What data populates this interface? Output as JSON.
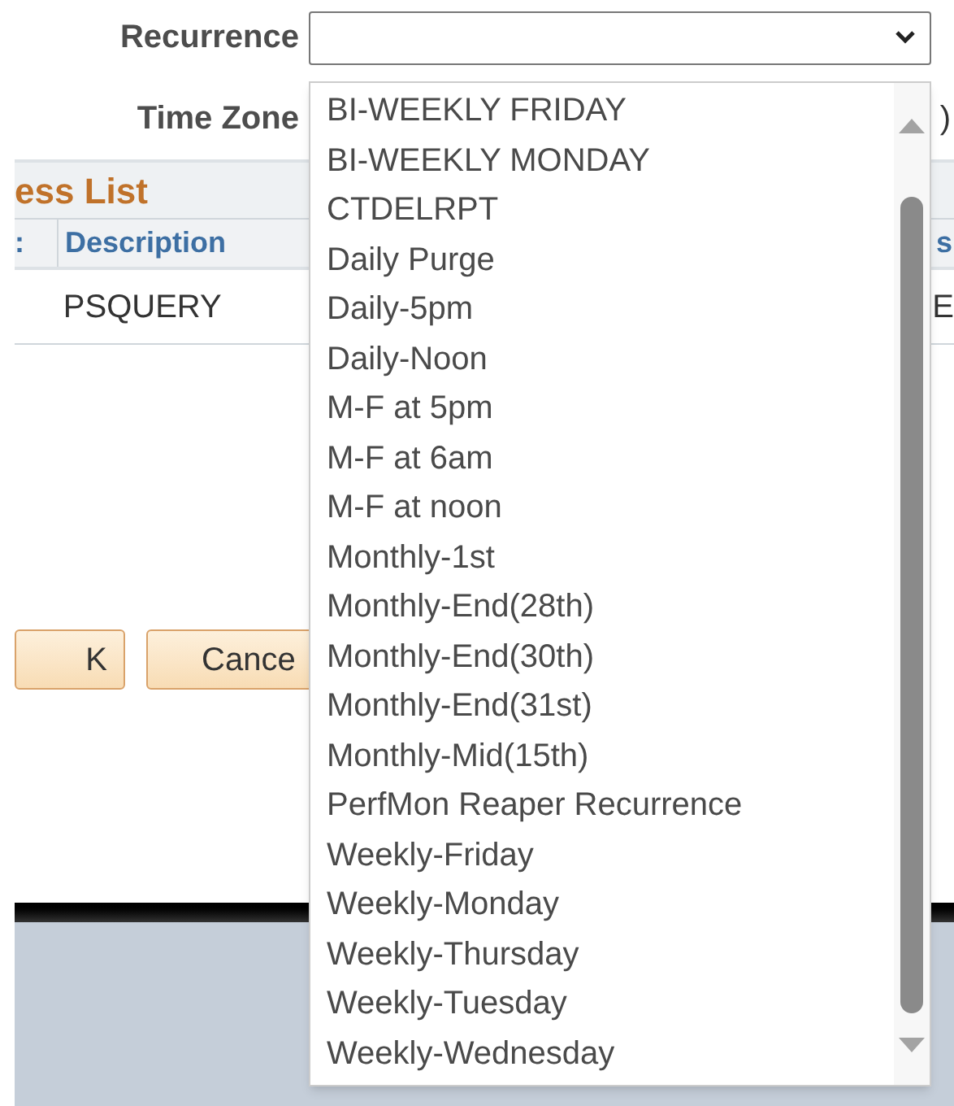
{
  "form": {
    "recurrence_label": "Recurrence",
    "time_zone_label": "Time Zone",
    "time_zone_value_fragment": ")"
  },
  "process_list": {
    "title": "ess List",
    "columns": [
      ":",
      "Description",
      "s"
    ],
    "rows": [
      [
        "",
        "PSQUERY",
        "E"
      ]
    ]
  },
  "buttons": [
    "K",
    "Cance"
  ],
  "dropdown": {
    "options": [
      {
        "label": "BI-WEEKLY FRIDAY",
        "selected": false
      },
      {
        "label": "BI-WEEKLY MONDAY",
        "selected": false
      },
      {
        "label": "CTDELRPT",
        "selected": false
      },
      {
        "label": "Daily Purge",
        "selected": false
      },
      {
        "label": "Daily-5pm",
        "selected": false
      },
      {
        "label": "Daily-Noon",
        "selected": false
      },
      {
        "label": "M-F at 5pm",
        "selected": false
      },
      {
        "label": "M-F at 6am",
        "selected": false
      },
      {
        "label": "M-F at noon",
        "selected": false
      },
      {
        "label": "Monthly-1st",
        "selected": false
      },
      {
        "label": "Monthly-End(28th)",
        "selected": false
      },
      {
        "label": "Monthly-End(30th)",
        "selected": false
      },
      {
        "label": "Monthly-End(31st)",
        "selected": false
      },
      {
        "label": "Monthly-Mid(15th)",
        "selected": false
      },
      {
        "label": "PerfMon Reaper Recurrence",
        "selected": false
      },
      {
        "label": "Weekly-Friday",
        "selected": false
      },
      {
        "label": "Weekly-Monday",
        "selected": false
      },
      {
        "label": "Weekly-Thursday",
        "selected": false
      },
      {
        "label": "Weekly-Tuesday",
        "selected": false
      },
      {
        "label": "Weekly-Wednesday",
        "selected": false
      }
    ]
  }
}
